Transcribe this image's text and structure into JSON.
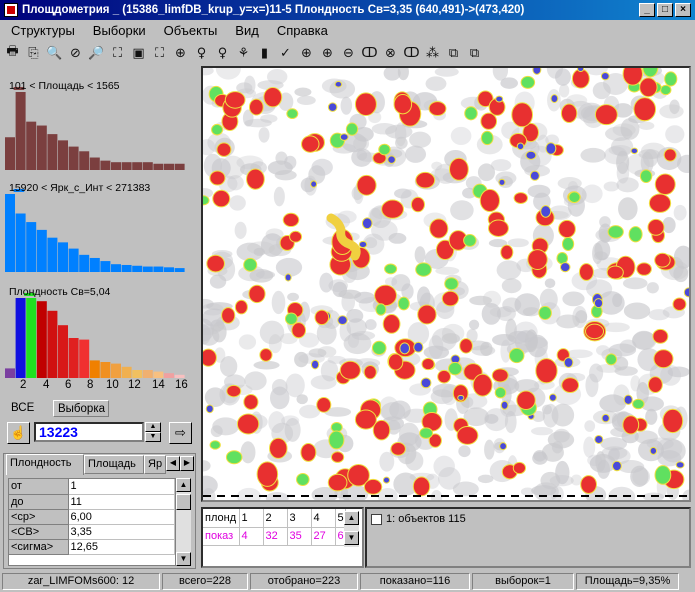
{
  "window": {
    "title": "Площдометрия  _ (15386_limfDB_krup_y=x=)11-5  Плондность Св=3,35  (640,491)->(473,420)",
    "minimize": "_",
    "maximize": "□",
    "close": "×"
  },
  "menu": [
    "Структуры",
    "Выборки",
    "Объекты",
    "Вид",
    "Справка"
  ],
  "toolbar_icons": [
    "print-icon",
    "copy-icon",
    "zoom-icon",
    "no-zoom-icon",
    "zoom-out-icon",
    "fit-icon",
    "frame-icon",
    "select-icon",
    "zoom-in-icon",
    "bulb-icon",
    "bulb-small-icon",
    "bug-icon",
    "eraser-icon",
    "check-icon",
    "plus-circle-icon",
    "plus-circle2-icon",
    "minus-circle-icon",
    "cc-icon",
    "x-circle-icon",
    "ring-icon",
    "dots-icon",
    "copy2-icon",
    "paste-icon"
  ],
  "toolbar_glyphs": [
    "🖶",
    "⎘",
    "🔍",
    "⊘",
    "🔎",
    "⛶",
    "▣",
    "⛶",
    "⊕",
    "♀",
    "♀",
    "⚘",
    "▮",
    "✓",
    "⊕",
    "⊕",
    "⊖",
    "ↀ",
    "⊗",
    "ↀ",
    "⁂",
    "⧉",
    "⧉"
  ],
  "histograms": [
    {
      "label": "101 < Площадь < 1565",
      "color": "#7b3f3f",
      "values": [
        42,
        100,
        62,
        57,
        46,
        38,
        30,
        24,
        16,
        12,
        10,
        10,
        10,
        10,
        8,
        8,
        8
      ],
      "marker": 1
    },
    {
      "label": "15920 < Ярк_с_Инт < 271383",
      "color": "#0080ff",
      "values": [
        100,
        75,
        64,
        54,
        44,
        38,
        30,
        22,
        18,
        14,
        10,
        9,
        8,
        7,
        7,
        6,
        5
      ],
      "marker": 1
    },
    {
      "label": "Плондность Св=5,04",
      "colors": [
        "#7a3fa0",
        "#1010e0",
        "#20e020",
        "#c00000",
        "#d01010",
        "#d81818",
        "#e02020",
        "#f03030",
        "#f08000",
        "#f09020",
        "#f0a040",
        "#f0b050",
        "#f0c060",
        "#f0b070",
        "#f8c080",
        "#f0a0a0",
        "#f8c0c0"
      ],
      "values": [
        12,
        100,
        100,
        96,
        84,
        66,
        50,
        48,
        22,
        20,
        18,
        14,
        10,
        10,
        8,
        6,
        4
      ],
      "marker": 2
    }
  ],
  "axis_ticks": [
    "2",
    "4",
    "6",
    "8",
    "10",
    "12",
    "14",
    "16"
  ],
  "tabs_sel": {
    "all": "ВСЕ",
    "sample": "Выборка"
  },
  "number_field": "13223",
  "prop_tabs": [
    "Плондность",
    "Площадь",
    "Яр"
  ],
  "prop_rows": [
    [
      "от",
      "1"
    ],
    [
      "до",
      "11"
    ],
    [
      "<ср>",
      "6,00"
    ],
    [
      "<СВ>",
      "3,35"
    ],
    [
      "<сигма>",
      "12,65"
    ]
  ],
  "bottom_grid": {
    "header": [
      "плонд",
      "1",
      "2",
      "3",
      "4",
      "5"
    ],
    "row": [
      "показ",
      "4",
      "32",
      "35",
      "27",
      "6"
    ]
  },
  "list_item": "1:  объектов 115",
  "status": [
    "zar_LIMFOMs600:  12",
    "всего=228",
    "отобрано=223",
    "показано=116",
    "выборок=1",
    "Площадь=9,35%"
  ]
}
